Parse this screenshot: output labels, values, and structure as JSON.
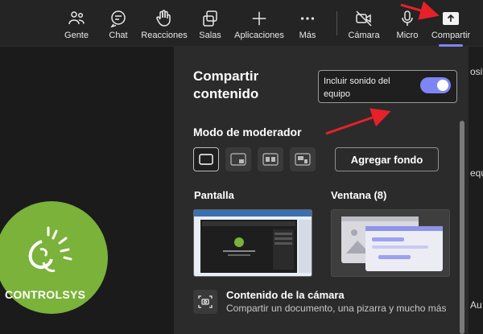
{
  "toolbar": {
    "people_label": "Gente",
    "chat_label": "Chat",
    "reactions_label": "Reacciones",
    "rooms_label": "Salas",
    "apps_label": "Aplicaciones",
    "more_label": "Más",
    "camera_label": "Cámara",
    "mic_label": "Micro",
    "share_label": "Compartir"
  },
  "share_panel": {
    "title": "Compartir contenido",
    "include_sound_label": "Incluir sonido del equipo",
    "include_sound_on": true,
    "presenter_mode_label": "Modo de moderador",
    "add_background_label": "Agregar fondo",
    "screen_label": "Pantalla",
    "window_label": "Ventana (8)",
    "camera_content_title": "Contenido de la cámara",
    "camera_content_subtitle": "Compartir un documento, una pizarra y mucho más"
  },
  "background": {
    "logo_text": "CONTROLSYS",
    "right_cut_1": "osit",
    "right_cut_2": "equ",
    "right_cut_3": "Au"
  },
  "colors": {
    "accent": "#7f85f5",
    "annotation_arrow": "#e8202a",
    "logo_green": "#7ab23a"
  },
  "icons": [
    "people-icon",
    "chat-icon",
    "reactions-icon",
    "rooms-icon",
    "apps-icon",
    "more-icon",
    "camera-off-icon",
    "mic-icon",
    "share-icon"
  ]
}
